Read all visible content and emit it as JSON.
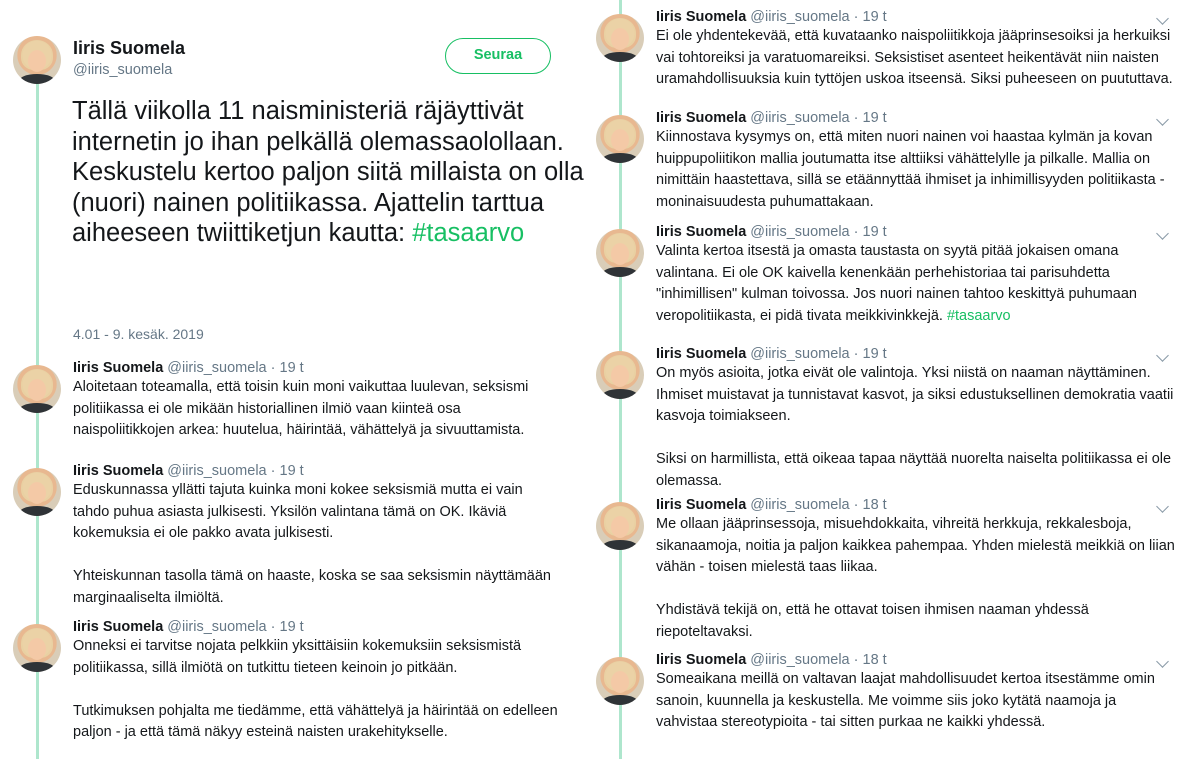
{
  "colors": {
    "accent": "#17bf63",
    "thread_line": "#aee6cd",
    "muted": "#657786"
  },
  "icons": {
    "avatar": "profile-photo-avatar",
    "menu": "chevron-down-icon"
  },
  "main_tweet": {
    "name": "Iiris Suomela",
    "handle": "@iiris_suomela",
    "follow_label": "Seuraa",
    "text": "Tällä viikolla 11 naisministeriä räjäyttivät internetin jo ihan pelkällä olemassaolollaan. Keskustelu kertoo paljon siitä millaista on olla (nuori) nainen politiikassa. Ajattelin tarttua aiheeseen twiittiketjun kautta: ",
    "hashtag": "#tasaarvo",
    "date": "4.01 - 9. kesäk. 2019"
  },
  "left_replies": [
    {
      "name": "Iiris Suomela",
      "handle": "@iiris_suomela",
      "sep": "·",
      "time": "19 t",
      "paragraphs": [
        "Aloitetaan toteamalla, että toisin kuin moni vaikuttaa luulevan, seksismi politiikassa ei ole mikään historiallinen ilmiö vaan kiinteä osa naispoliitikkojen arkea: huutelua, häirintää, vähättelyä ja sivuuttamista."
      ]
    },
    {
      "name": "Iiris Suomela",
      "handle": "@iiris_suomela",
      "sep": "·",
      "time": "19 t",
      "paragraphs": [
        "Eduskunnassa yllätti tajuta kuinka moni kokee seksismiä mutta ei vain tahdo puhua asiasta julkisesti. Yksilön valintana tämä on OK. Ikäviä kokemuksia ei ole pakko avata julkisesti.",
        "Yhteiskunnan tasolla tämä on haaste, koska se saa seksismin näyttämään marginaaliselta ilmiöltä."
      ]
    },
    {
      "name": "Iiris Suomela",
      "handle": "@iiris_suomela",
      "sep": "·",
      "time": "19 t",
      "paragraphs": [
        "Onneksi ei tarvitse nojata pelkkiin yksittäisiin kokemuksiin seksismistä politiikassa, sillä ilmiötä on tutkittu tieteen keinoin jo pitkään.",
        "Tutkimuksen pohjalta me tiedämme, että vähättelyä ja häirintää on edelleen paljon - ja että tämä näkyy esteinä naisten urakehitykselle."
      ]
    }
  ],
  "right_replies": [
    {
      "name": "Iiris Suomela",
      "handle": "@iiris_suomela",
      "sep": "·",
      "time": "19 t",
      "paragraphs": [
        "Ei ole yhdentekevää, että kuvataanko naispoliitikkoja jääprinsesoiksi ja herkuiksi vai tohtoreiksi ja varatuomareiksi. Seksistiset asenteet heikentävät niin naisten uramahdollisuuksia kuin tyttöjen uskoa itseensä. Siksi puheeseen on puututtava."
      ]
    },
    {
      "name": "Iiris Suomela",
      "handle": "@iiris_suomela",
      "sep": "·",
      "time": "19 t",
      "paragraphs": [
        "Kiinnostava kysymys on, että miten nuori nainen voi haastaa kylmän ja kovan huippupoliitikon mallia joutumatta itse alttiiksi vähättelylle ja pilkalle. Mallia on nimittäin haastettava, sillä se etäännyttää ihmiset ja inhimillisyyden politiikasta - moninaisuudesta puhumattakaan."
      ]
    },
    {
      "name": "Iiris Suomela",
      "handle": "@iiris_suomela",
      "sep": "·",
      "time": "19 t",
      "paragraphs": [
        "Valinta kertoa itsestä ja omasta taustasta on syytä pitää jokaisen omana valintana. Ei ole OK kaivella kenenkään perhehistoriaa tai parisuhdetta \"inhimillisen\" kulman toivossa. Jos nuori nainen tahtoo keskittyä puhumaan veropolitiikasta, ei pidä tivata meikkivinkkejä. "
      ],
      "hashtag": "#tasaarvo"
    },
    {
      "name": "Iiris Suomela",
      "handle": "@iiris_suomela",
      "sep": "·",
      "time": "19 t",
      "paragraphs": [
        "On myös asioita, jotka eivät ole valintoja. Yksi niistä on naaman näyttäminen. Ihmiset muistavat ja tunnistavat kasvot, ja siksi edustuksellinen demokratia vaatii kasvoja toimiakseen.",
        "Siksi on harmillista, että oikeaa tapaa näyttää nuorelta naiselta politiikassa ei ole olemassa."
      ]
    },
    {
      "name": "Iiris Suomela",
      "handle": "@iiris_suomela",
      "sep": "·",
      "time": "18 t",
      "paragraphs": [
        "Me ollaan jääprinsessoja, misuehdokkaita, vihreitä herkkuja, rekkalesboja, sikanaamoja, noitia ja paljon kaikkea pahempaa. Yhden mielestä meikkiä on liian vähän - toisen mielestä taas liikaa.",
        "Yhdistävä tekijä on, että he ottavat toisen ihmisen naaman yhdessä riepoteltavaksi."
      ]
    },
    {
      "name": "Iiris Suomela",
      "handle": "@iiris_suomela",
      "sep": "·",
      "time": "18 t",
      "paragraphs": [
        "Someaikana meillä on valtavan laajat mahdollisuudet kertoa itsestämme omin sanoin, kuunnella ja keskustella. Me voimme siis joko kytätä naamoja ja vahvistaa stereotypioita - tai sitten purkaa ne kaikki yhdessä."
      ]
    }
  ]
}
